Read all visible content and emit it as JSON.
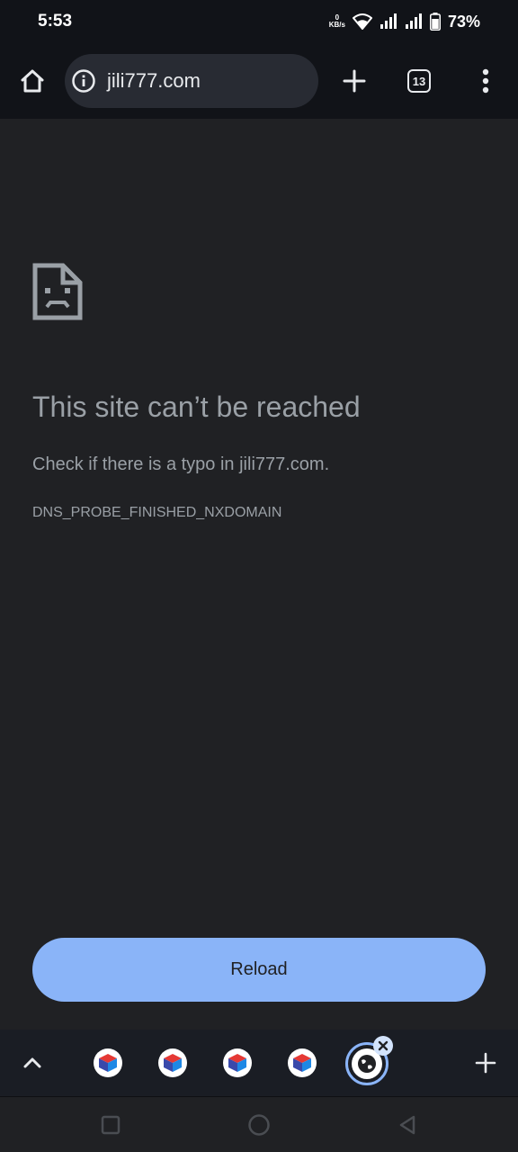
{
  "status_bar": {
    "time": "5:53",
    "network_speed_value": "0",
    "network_speed_unit": "KB/s",
    "battery_percent": "73%"
  },
  "toolbar": {
    "url": "jili777.com",
    "tab_count": "13"
  },
  "error": {
    "title": "This site can’t be reached",
    "suggestion": "Check if there is a typo in jili777.com.",
    "code": "DNS_PROBE_FINISHED_NXDOMAIN",
    "reload_label": "Reload"
  },
  "tab_strip": {
    "tabs": [
      {
        "icon": "cube-favicon-icon"
      },
      {
        "icon": "cube-favicon-icon"
      },
      {
        "icon": "cube-favicon-icon"
      },
      {
        "icon": "cube-favicon-icon"
      },
      {
        "icon": "globe-favicon-icon",
        "active": true
      }
    ]
  },
  "colors": {
    "background": "#202124",
    "toolbar": "#111318",
    "accent": "#8ab4f8",
    "text_secondary": "#9aa0a6"
  }
}
